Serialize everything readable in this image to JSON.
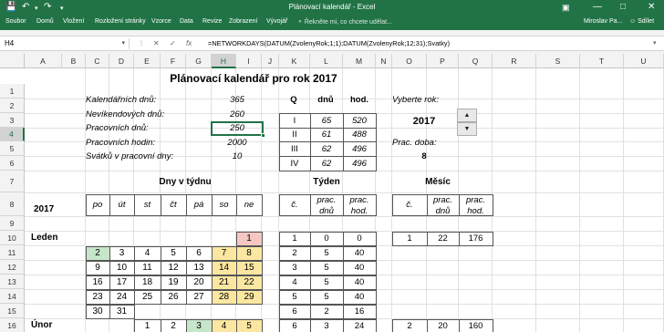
{
  "titlebar": {
    "title": "Plánovací kalendář - Excel",
    "save_icon": "save-icon",
    "undo_icon": "undo-icon",
    "redo_icon": "redo-icon",
    "customize_icon": "customize-quick-access-icon"
  },
  "ribbon": {
    "tabs": [
      "Soubor",
      "Domů",
      "Vložení",
      "Rozložení stránky",
      "Vzorce",
      "Data",
      "Revize",
      "Zobrazení",
      "Vývojář"
    ],
    "tellme": "Řekněte mi, co chcete udělat...",
    "user": "Miroslav Pa...",
    "share": "Sdílet"
  },
  "formula_bar": {
    "namebox": "H4",
    "cancel": "✕",
    "enter": "✓",
    "fx": "fx",
    "formula": "=NETWORKDAYS(DATUM(ZvolenyRok;1;1);DATUM(ZvolenyRok;12;31);Svatky)"
  },
  "columns": [
    "A",
    "B",
    "C",
    "D",
    "E",
    "F",
    "G",
    "H",
    "I",
    "J",
    "K",
    "L",
    "M",
    "N",
    "O",
    "P",
    "Q",
    "R",
    "S",
    "T",
    "U"
  ],
  "rows": [
    "1",
    "2",
    "3",
    "4",
    "5",
    "6",
    "7",
    "8",
    "9",
    "10",
    "11",
    "12",
    "13",
    "14",
    "15",
    "16"
  ],
  "selected_cell": "H4",
  "sheet": {
    "title": "Plánovací kalendář pro rok 2017",
    "stats": [
      {
        "label": "Kalendářních dnů:",
        "value": "365"
      },
      {
        "label": "Nevíkendových dnů:",
        "value": "260"
      },
      {
        "label": "Pracovních dnů:",
        "value": "250"
      },
      {
        "label": "Pracovních hodin:",
        "value": "2000"
      },
      {
        "label": "Svátků v pracovní dny:",
        "value": "10"
      }
    ],
    "quarters": {
      "headers": [
        "Q",
        "dnů",
        "hod."
      ],
      "rows": [
        [
          "I",
          "65",
          "520"
        ],
        [
          "II",
          "61",
          "488"
        ],
        [
          "III",
          "62",
          "496"
        ],
        [
          "IV",
          "62",
          "496"
        ]
      ]
    },
    "year_select": {
      "label": "Vyberte rok:",
      "value": "2017",
      "up": "▲",
      "down": "▼"
    },
    "work_time": {
      "label": "Prac. doba:",
      "value": "8"
    },
    "sections": {
      "weekdays": "Dny v týdnu",
      "week": "Týden",
      "month": "Měsíc"
    },
    "year_label": "2017",
    "weekday_headers": [
      "po",
      "út",
      "st",
      "čt",
      "pá",
      "so",
      "ne"
    ],
    "week_headers": [
      [
        "č."
      ],
      [
        "prac.",
        "dnů"
      ],
      [
        "prac.",
        "hod."
      ]
    ],
    "month_headers": [
      [
        "č."
      ],
      [
        "prac.",
        "dnů"
      ],
      [
        "prac.",
        "hod."
      ]
    ],
    "months": [
      {
        "name": "Leden",
        "weeks": [
          {
            "days": [
              "",
              "",
              "",
              "",
              "",
              "",
              "1"
            ],
            "week": [
              "1",
              "0",
              "0"
            ]
          },
          {
            "days": [
              "2",
              "3",
              "4",
              "5",
              "6",
              "7",
              "8"
            ],
            "week": [
              "2",
              "5",
              "40"
            ]
          },
          {
            "days": [
              "9",
              "10",
              "11",
              "12",
              "13",
              "14",
              "15"
            ],
            "week": [
              "3",
              "5",
              "40"
            ]
          },
          {
            "days": [
              "16",
              "17",
              "18",
              "19",
              "20",
              "21",
              "22"
            ],
            "week": [
              "4",
              "5",
              "40"
            ]
          },
          {
            "days": [
              "23",
              "24",
              "25",
              "26",
              "27",
              "28",
              "29"
            ],
            "week": [
              "5",
              "5",
              "40"
            ]
          },
          {
            "days": [
              "30",
              "31",
              "",
              "",
              "",
              "",
              ""
            ],
            "week": [
              "6",
              "2",
              "16"
            ]
          }
        ],
        "month": [
          "1",
          "22",
          "176"
        ]
      },
      {
        "name": "Únor",
        "weeks": [
          {
            "days": [
              "",
              "",
              "1",
              "2",
              "3",
              "4",
              "5"
            ],
            "week": [
              "6",
              "3",
              "24"
            ]
          }
        ],
        "month": [
          "2",
          "20",
          "160"
        ]
      }
    ],
    "colors": {
      "holiday": "#f4c7c3",
      "weekend": "#fbe7a1",
      "first_workday": "#c6e6c9",
      "accent": "#217346"
    }
  }
}
